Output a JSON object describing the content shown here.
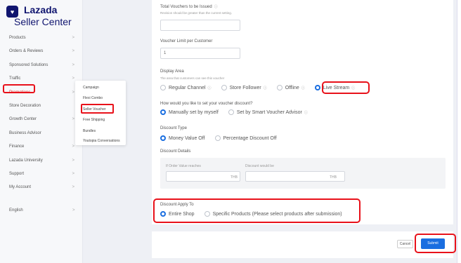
{
  "brand": {
    "name": "Lazada",
    "subtitle": "Seller Center"
  },
  "sidebar": {
    "items": [
      {
        "label": "Products"
      },
      {
        "label": "Orders & Reviews"
      },
      {
        "label": "Sponsored Solutions"
      },
      {
        "label": "Traffic"
      },
      {
        "label": "Promotions"
      },
      {
        "label": "Store Decoration"
      },
      {
        "label": "Growth Center"
      },
      {
        "label": "Business Advisor"
      },
      {
        "label": "Finance"
      },
      {
        "label": "Lazada University"
      },
      {
        "label": "Support"
      },
      {
        "label": "My Account"
      }
    ],
    "language": "English",
    "chevron": ">"
  },
  "submenu": {
    "items": [
      "Campaign",
      "Flexi Combo",
      "Seller Voucher",
      "Free Shipping",
      "Bundles",
      "Youtopia Conversations"
    ]
  },
  "form": {
    "total_vouchers": {
      "label": "Total Vouchers to be Issued",
      "hint": "Revision should be greater than the current setting."
    },
    "voucher_limit": {
      "label": "Voucher Limit per Customer",
      "value": "1"
    },
    "display_area": {
      "label": "Display Area",
      "hint": "The area that customers can see this voucher",
      "options": [
        "Regular Channel",
        "Store Follower",
        "Offline",
        "Live Stream"
      ],
      "selected": "Live Stream"
    },
    "set_discount": {
      "label": "How would you like to set your voucher discount?",
      "options": [
        "Manually set by myself",
        "Set by Smart Voucher Advisor"
      ],
      "selected": "Manually set by myself"
    },
    "discount_type": {
      "label": "Discount Type",
      "options": [
        "Money Value Off",
        "Percentage Discount Off"
      ],
      "selected": "Money Value Off"
    },
    "discount_details": {
      "label": "Discount Details",
      "order_value_label": "If Order Value reaches",
      "discount_label": "Discount would be",
      "currency": "THB"
    },
    "discount_apply": {
      "label": "Discount Apply To",
      "options": [
        "Entire Shop",
        "Specific Products (Please select products after submission)"
      ],
      "selected": "Entire Shop"
    },
    "info_symbol": "ⓘ"
  },
  "actions": {
    "cancel": "Cancel",
    "submit": "Submit"
  },
  "colors": {
    "accent": "#1a6ee0",
    "highlight": "#e8111a",
    "brand": "#10156f"
  }
}
